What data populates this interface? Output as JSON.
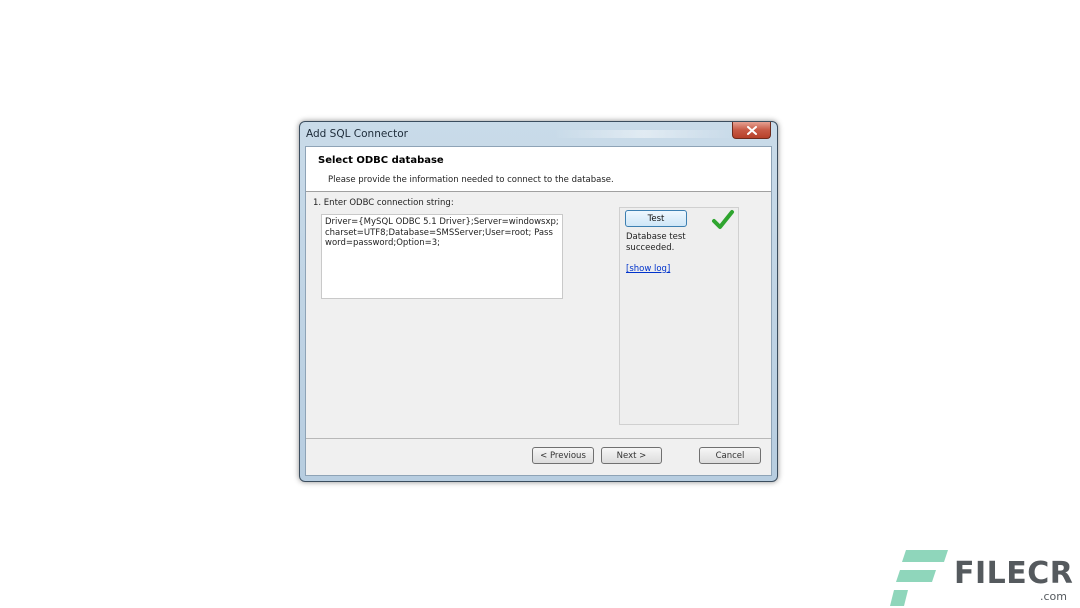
{
  "window": {
    "title": "Add SQL Connector"
  },
  "header": {
    "title": "Select ODBC database",
    "subtitle": "Please provide the information needed to connect to the database."
  },
  "form": {
    "connection_label": "1. Enter ODBC connection string:",
    "connection_string": "Driver={MySQL ODBC 5.1 Driver};Server=windowsxp;charset=UTF8;Database=SMSServer;User=root; Password=password;Option=3;"
  },
  "test_panel": {
    "test_label": "Test",
    "status_text": "Database test succeeded.",
    "show_log_label": "[show log]",
    "check_icon": "check-icon",
    "check_color": "#2fa52f"
  },
  "buttons": {
    "previous_label": "< Previous",
    "next_label": "Next >",
    "cancel_label": "Cancel"
  },
  "watermark": {
    "brand": "FILECR",
    "domain": ".com",
    "accent": "#8fd6bb"
  }
}
